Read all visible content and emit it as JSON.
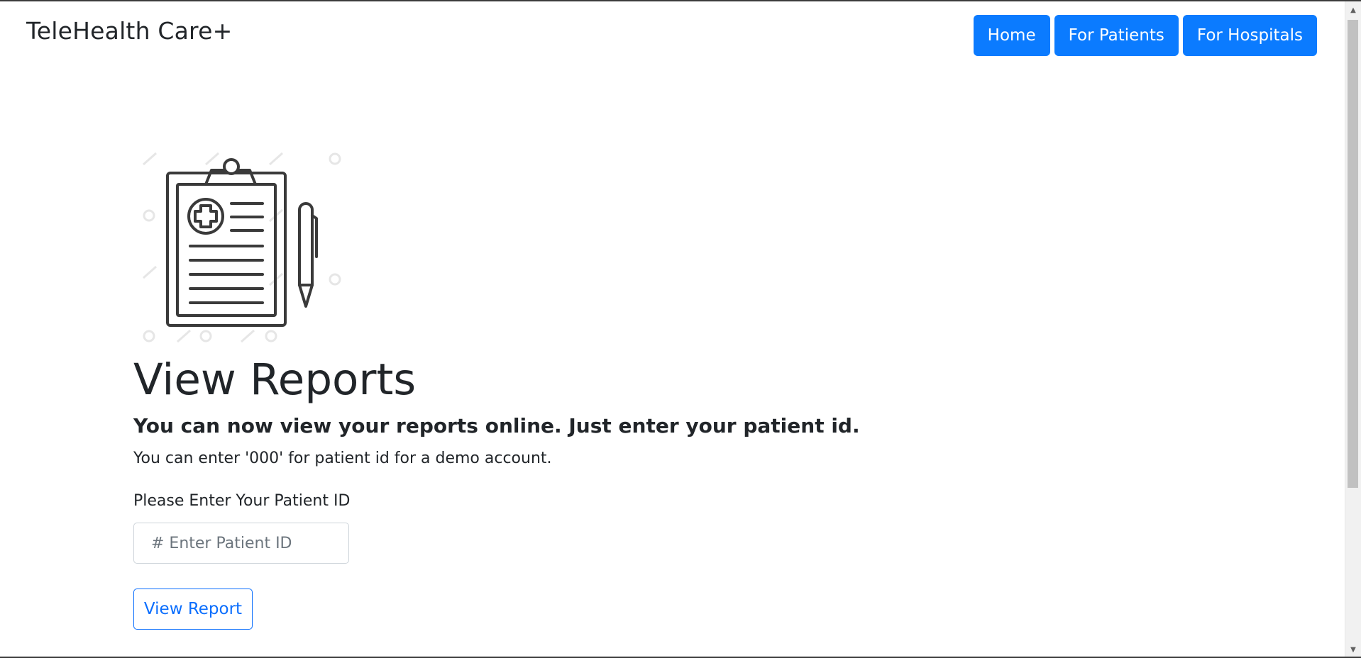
{
  "navbar": {
    "brand": "TeleHealth Care+",
    "links": [
      "Home",
      "For Patients",
      "For Hospitals"
    ]
  },
  "illustration": {
    "icon": "clipboard-medical-report-with-pen-icon"
  },
  "main": {
    "title": "View Reports",
    "lead": "You can now view your reports online. Just enter your patient id.",
    "note": "You can enter '000' for patient id for a demo account.",
    "patient_id_label": "Please Enter Your Patient ID",
    "patient_id_placeholder": "# Enter Patient ID",
    "patient_id_value": "",
    "submit_label": "View Report"
  },
  "colors": {
    "primary": "#0b7bff",
    "text": "#212529",
    "outline_button": "#0b6efd"
  }
}
